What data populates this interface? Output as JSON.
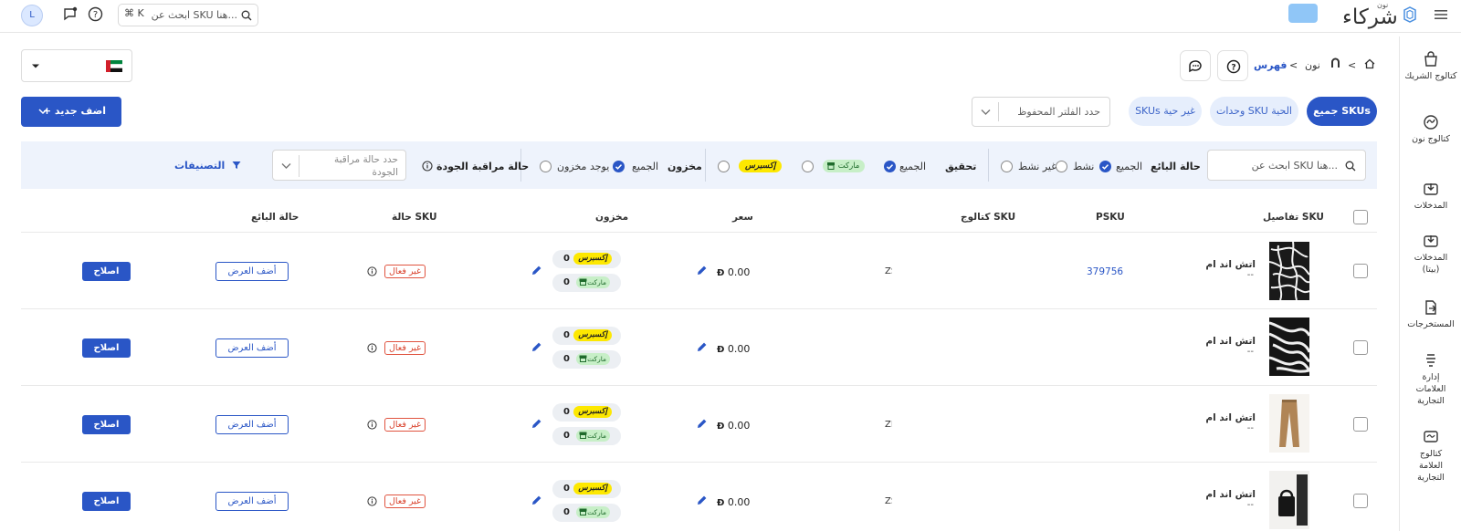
{
  "header": {
    "avatar_initial": "L",
    "search_placeholder": "ابحث عن SKU هنا...",
    "shortcut": "⌘ K",
    "logo_small": "نون",
    "logo_main": "شركاء"
  },
  "sidebar": {
    "items": [
      {
        "label": "كتالوج الشريك",
        "icon": "shopping-bag-icon"
      },
      {
        "label": "كتالوج نون",
        "icon": "noon-catalog-icon"
      },
      {
        "label": "المدخلات",
        "icon": "inbox-download-icon"
      },
      {
        "label": "المدخلات (بيتا)",
        "icon": "inbox-download-beta-icon"
      },
      {
        "label": "المستخرجات",
        "icon": "export-file-icon"
      },
      {
        "label": "إدارة العلامات التجارية",
        "icon": "brand-management-icon"
      },
      {
        "label": "كتالوج العلامة التجارية",
        "icon": "brand-catalog-icon"
      }
    ]
  },
  "breadcrumb": {
    "items": [
      "نون",
      "فهرس"
    ]
  },
  "tabs": [
    {
      "label": "جميع SKUs",
      "active": true
    },
    {
      "label": "وحدات SKU الحية",
      "active": false
    },
    {
      "label": "SKUs غير حية",
      "active": false
    }
  ],
  "saved_filter_placeholder": "حدد الفلتر المحفوظ",
  "add_new_label": "+ اضف جديد",
  "filters": {
    "search_placeholder": "ابحث عن SKU هنا...",
    "seller_status": {
      "label": "حالة البائع",
      "options": [
        "الجميع",
        "نشط",
        "غير نشط"
      ],
      "selected": "الجميع"
    },
    "fulfillment": {
      "label": "تحقيق",
      "options": [
        "الجميع",
        "ماركت",
        "إكسبرس"
      ],
      "selected": "الجميع"
    },
    "stock": {
      "label": "مخزون",
      "options": [
        "الجميع",
        "يوجد مخزون"
      ],
      "selected": "الجميع"
    },
    "qc": {
      "label": "حالة مراقبة الجودة",
      "placeholder": "حدد حالة مراقبة الجودة"
    },
    "categories_label": "التصنيفات"
  },
  "table": {
    "headers": {
      "details": "تفاصيل SKU",
      "psku": "PSKU",
      "catalog": "كتالوج SKU",
      "price": "سعر",
      "stock": "مخزون",
      "sku_status": "حالة SKU",
      "seller_status": "حالة البائع"
    },
    "rows": [
      {
        "name": "اتش اند ام",
        "sub": "--",
        "psku": "379756",
        "catalog": "ZS",
        "price": "0.00",
        "express_qty": "0",
        "market_qty": "0",
        "status": "غير فعال",
        "offer": "أضف العرض",
        "fix": "اصلاح",
        "thumb": "scarf"
      },
      {
        "name": "اتش اند ام",
        "sub": "--",
        "psku": "",
        "catalog": "",
        "price": "0.00",
        "express_qty": "0",
        "market_qty": "0",
        "status": "غير فعال",
        "offer": "أضف العرض",
        "fix": "اصلاح",
        "thumb": "zebra"
      },
      {
        "name": "اتش اند ام",
        "sub": "--",
        "psku": "",
        "catalog": "ZI",
        "price": "0.00",
        "express_qty": "0",
        "market_qty": "0",
        "status": "غير فعال",
        "offer": "أضف العرض",
        "fix": "اصلاح",
        "thumb": "pants"
      },
      {
        "name": "اتش اند ام",
        "sub": "--",
        "psku": "",
        "catalog": "ZS",
        "price": "0.00",
        "express_qty": "0",
        "market_qty": "0",
        "status": "غير فعال",
        "offer": "أضف العرض",
        "fix": "اصلاح",
        "thumb": "bag"
      }
    ],
    "express_label": "إكسبرس",
    "market_label": "ماركت"
  },
  "colors": {
    "primary": "#2a56c6",
    "express": "#fde800",
    "market": "#c7efc7",
    "danger": "#d9412b"
  }
}
